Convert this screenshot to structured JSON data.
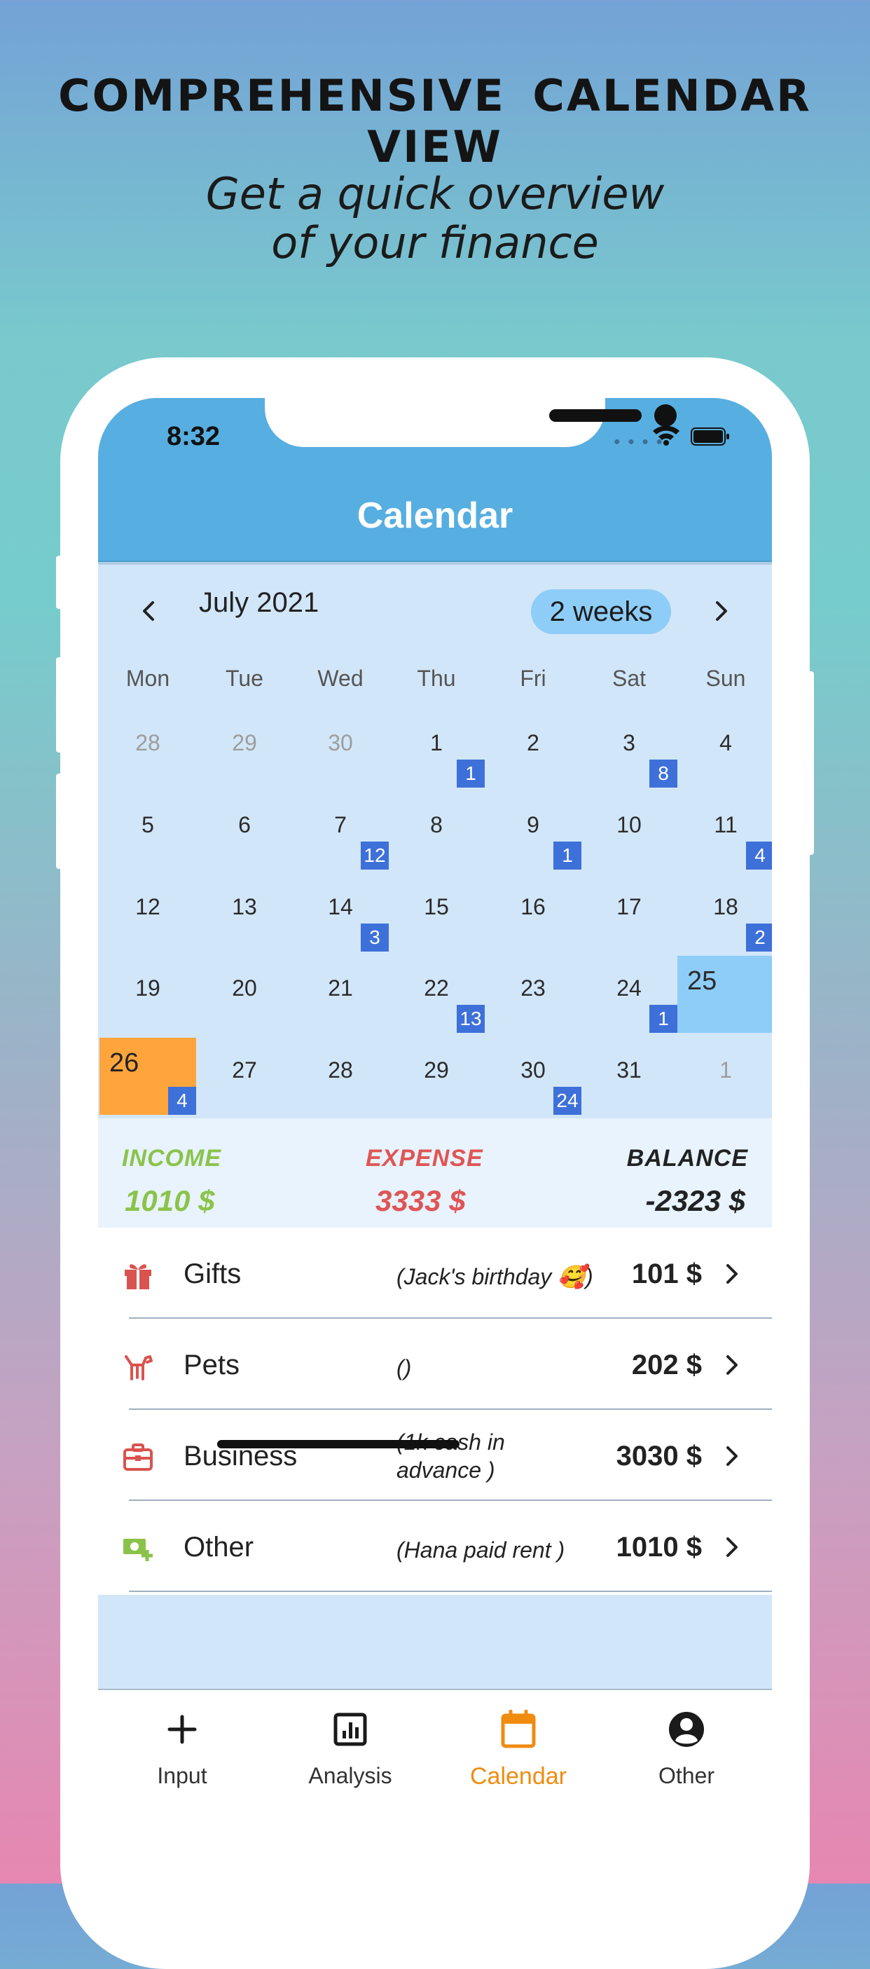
{
  "promo": {
    "title": "COMPREHENSIVE CALENDAR VIEW",
    "subtitle_line1": "Get a quick overview",
    "subtitle_line2": "of your finance"
  },
  "status_bar": {
    "time": "8:32"
  },
  "app_bar": {
    "title": "Calendar"
  },
  "calendar": {
    "month_label": "July 2021",
    "range_label": "2 weeks",
    "weekdays": [
      "Mon",
      "Tue",
      "Wed",
      "Thu",
      "Fri",
      "Sat",
      "Sun"
    ],
    "weeks": [
      [
        {
          "day": "28",
          "muted": true
        },
        {
          "day": "29",
          "muted": true
        },
        {
          "day": "30",
          "muted": true
        },
        {
          "day": "1",
          "badge": "1"
        },
        {
          "day": "2"
        },
        {
          "day": "3",
          "badge": "8"
        },
        {
          "day": "4"
        }
      ],
      [
        {
          "day": "5"
        },
        {
          "day": "6"
        },
        {
          "day": "7",
          "badge": "12"
        },
        {
          "day": "8"
        },
        {
          "day": "9",
          "badge": "1"
        },
        {
          "day": "10"
        },
        {
          "day": "11",
          "badge": "4"
        }
      ],
      [
        {
          "day": "12"
        },
        {
          "day": "13"
        },
        {
          "day": "14",
          "badge": "3"
        },
        {
          "day": "15"
        },
        {
          "day": "16"
        },
        {
          "day": "17"
        },
        {
          "day": "18",
          "badge": "2"
        }
      ],
      [
        {
          "day": "19"
        },
        {
          "day": "20"
        },
        {
          "day": "21"
        },
        {
          "day": "22",
          "badge": "13"
        },
        {
          "day": "23"
        },
        {
          "day": "24",
          "badge": "1"
        },
        {
          "day": "25",
          "today": true
        }
      ],
      [
        {
          "day": "26",
          "selected": true,
          "badge": "4"
        },
        {
          "day": "27"
        },
        {
          "day": "28"
        },
        {
          "day": "29"
        },
        {
          "day": "30",
          "badge": "24"
        },
        {
          "day": "31"
        },
        {
          "day": "1",
          "muted": true
        }
      ]
    ]
  },
  "summary": {
    "income_label": "INCOME",
    "income_value": "1010 $",
    "expense_label": "EXPENSE",
    "expense_value": "3333 $",
    "balance_label": "BALANCE",
    "balance_value": "-2323 $"
  },
  "transactions": [
    {
      "icon": "gift-icon",
      "category": "Gifts",
      "note": "(Jack's birthday 🥰)",
      "amount": "101 $"
    },
    {
      "icon": "pet-icon",
      "category": "Pets",
      "note": "()",
      "amount": "202 $"
    },
    {
      "icon": "briefcase-icon",
      "category": "Business",
      "note_line1": "(1k cash in",
      "note_line2": "advance )",
      "amount": "3030 $"
    },
    {
      "icon": "cash-plus-icon",
      "category": "Other",
      "note": "(Hana paid rent )",
      "amount": "1010 $"
    }
  ],
  "tabs": [
    {
      "label": "Input",
      "icon": "plus-icon"
    },
    {
      "label": "Analysis",
      "icon": "chart-icon"
    },
    {
      "label": "Calendar",
      "icon": "calendar-icon",
      "active": true
    },
    {
      "label": "Other",
      "icon": "account-icon"
    }
  ],
  "colors": {
    "app_bar": "#57aee0",
    "calendar_bg": "#d2e6f9",
    "today_highlight": "#8ecdf8",
    "selected_day": "#ffa53c",
    "badge": "#3e70d9",
    "income": "#8bc34a",
    "expense": "#e05555",
    "balance": "#222222",
    "active_tab": "#f08c10"
  }
}
